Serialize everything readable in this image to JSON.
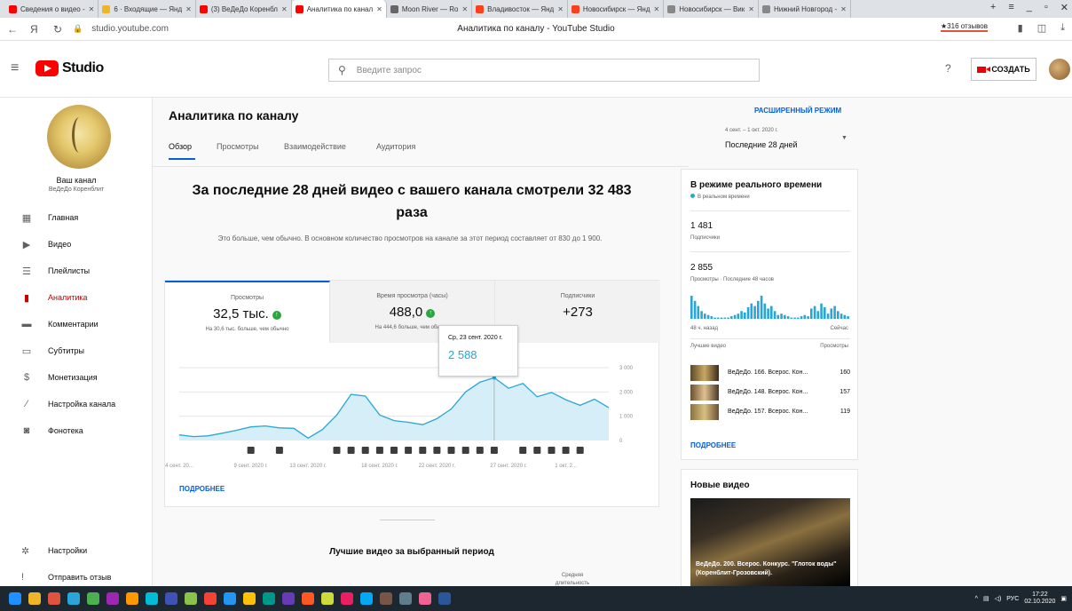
{
  "browser": {
    "tabs": [
      {
        "label": "Сведения о видео - ",
        "color": "#ff0000"
      },
      {
        "label": "6 · Входящие — Янд",
        "color": "#f0b429"
      },
      {
        "label": "(3) ВеДеДо Коренбл",
        "color": "#ff0000"
      },
      {
        "label": "Аналитика по канал",
        "color": "#ff0000",
        "active": true
      },
      {
        "label": "Moon River — Ro",
        "color": "#666666"
      },
      {
        "label": "Владивосток — Янд",
        "color": "#fc3f1d"
      },
      {
        "label": "Новосибирск — Янд",
        "color": "#fc3f1d"
      },
      {
        "label": "Новосибирск — Вик",
        "color": "#888888"
      },
      {
        "label": "Нижний Новгород -",
        "color": "#888888"
      }
    ],
    "url": "studio.youtube.com",
    "page_title": "Аналитика по каналу - YouTube Studio",
    "reviews": "★316 отзывов"
  },
  "header": {
    "logo_text": "Studio",
    "search_placeholder": "Введите запрос",
    "create_label": "СОЗДАТЬ"
  },
  "sidebar": {
    "channel_title": "Ваш канал",
    "channel_name": "ВеДеДо Коренблит",
    "items": [
      {
        "label": "Главная",
        "icon": "dashboard-icon"
      },
      {
        "label": "Видео",
        "icon": "video-icon"
      },
      {
        "label": "Плейлисты",
        "icon": "playlist-icon"
      },
      {
        "label": "Аналитика",
        "icon": "analytics-icon",
        "active": true
      },
      {
        "label": "Комментарии",
        "icon": "comments-icon"
      },
      {
        "label": "Субтитры",
        "icon": "subtitles-icon"
      },
      {
        "label": "Монетизация",
        "icon": "dollar-icon"
      },
      {
        "label": "Настройка канала",
        "icon": "wand-icon"
      },
      {
        "label": "Фонотека",
        "icon": "audio-library-icon"
      }
    ],
    "bottom": [
      {
        "label": "Настройки",
        "icon": "gear-icon"
      },
      {
        "label": "Отправить отзыв",
        "icon": "feedback-icon"
      }
    ]
  },
  "main": {
    "title": "Аналитика по каналу",
    "tabs": [
      "Обзор",
      "Просмотры",
      "Взаимодействие",
      "Аудитория"
    ],
    "advanced": "РАСШИРЕННЫЙ РЕЖИМ",
    "date_range": "4 сент. – 1 окт. 2020 г.",
    "date_period": "Последние 28 дней",
    "headline": "За последние 28 дней видео с вашего канала смотрели 32 483 раза",
    "subline": "Это больше, чем обычно. В основном количество просмотров на канале за этот период составляет от 830 до 1 900.",
    "kpis": [
      {
        "label": "Просмотры",
        "value": "32,5 тыс.",
        "note": "На 30,6 тыс. больше, чем обычно",
        "up": true
      },
      {
        "label": "Время просмотра (часы)",
        "value": "488,0",
        "note": "На 444,6 больше, чем обычно",
        "up": true
      },
      {
        "label": "Подписчики",
        "value": "+273",
        "note": "",
        "up": false
      }
    ],
    "tooltip": {
      "date": "Ср, 23 сент. 2020 г.",
      "value": "2 588"
    },
    "more": "ПОДРОБНЕЕ",
    "top_videos_title": "Лучшие видео за выбранный период",
    "avg_duration": "Средняя длительность"
  },
  "chart_data": {
    "type": "line",
    "x": [
      "4 сент.",
      "5 сент.",
      "6 сент.",
      "7 сент.",
      "8 сент.",
      "9 сент.",
      "10 сент.",
      "11 сент.",
      "12 сент.",
      "13 сент.",
      "14 сент.",
      "15 сент.",
      "16 сент.",
      "17 сент.",
      "18 сент.",
      "19 сент.",
      "20 сент.",
      "21 сент.",
      "22 сент.",
      "23 сент.",
      "24 сент.",
      "25 сент.",
      "26 сент.",
      "27 сент.",
      "28 сент.",
      "29 сент.",
      "30 сент.",
      "1 окт."
    ],
    "series": [
      {
        "values": [
          230,
          160,
          190,
          300,
          420,
          560,
          600,
          520,
          500,
          100,
          450,
          1050,
          1900,
          1830,
          1050,
          820,
          750,
          650,
          900,
          1300,
          2000,
          2400,
          2588,
          2150,
          2350,
          1800,
          1980,
          1680,
          1450,
          1700,
          1350
        ]
      }
    ],
    "x_ticks": [
      "4 сент. 20...",
      "9 сент. 2020 г.",
      "13 сент. 2020 г.",
      "18 сент. 2020 г.",
      "22 сент. 2020 г.",
      "27 сент. 2020 г.",
      "1 окт. 2..."
    ],
    "y_ticks": [
      "0",
      "1 000",
      "2 000",
      "3 000"
    ],
    "ylim": [
      0,
      3000
    ],
    "grid": true,
    "color": "#2aa6d6",
    "fill": "#d6eef8"
  },
  "realtime": {
    "title": "В режиме реального времени",
    "subtitle": "В реальном времени",
    "subs": "1 481",
    "subs_label": "Подписчики",
    "views": "2 855",
    "views_label": "Просмотры · Последние 48 часов",
    "bars_ago": "48 ч. назад",
    "bars_now": "Сейчас",
    "bars": [
      18,
      14,
      10,
      6,
      4,
      3,
      2,
      1,
      1,
      1,
      1,
      1,
      2,
      3,
      4,
      6,
      5,
      9,
      12,
      10,
      14,
      18,
      12,
      8,
      10,
      6,
      3,
      4,
      3,
      2,
      1,
      1,
      1,
      2,
      3,
      2,
      8,
      10,
      6,
      12,
      9,
      4,
      8,
      10,
      6,
      4,
      3,
      2
    ],
    "col1": "Лучшие видео",
    "col2": "Просмотры",
    "videos": [
      {
        "title": "ВеДеДо. 166. Всерос. Кон...",
        "views": "160"
      },
      {
        "title": "ВеДеДо. 148. Всерос. Кон...",
        "views": "157"
      },
      {
        "title": "ВеДеДо. 157. Всерос. Кон...",
        "views": "119"
      }
    ],
    "more": "ПОДРОБНЕЕ"
  },
  "new_video": {
    "title": "Новые видео",
    "caption": "ВеДеДо. 200. Всерос. Конкурс. \"Глоток воды\" (Коренблит-Грозовский)."
  },
  "taskbar": {
    "lang": "РУС",
    "time": "17:22",
    "date": "02.10.2020"
  }
}
